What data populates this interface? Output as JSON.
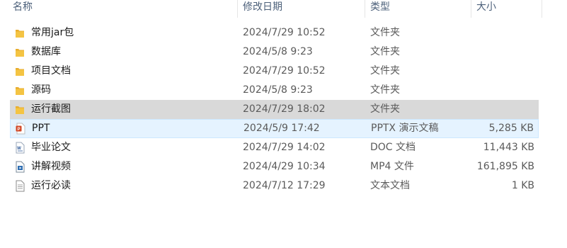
{
  "columns": {
    "name": "名称",
    "date": "修改日期",
    "type": "类型",
    "size": "大小"
  },
  "files": [
    {
      "name": "常用jar包",
      "date": "2024/7/29 10:52",
      "type": "文件夹",
      "size": "",
      "icon": "folder-icon",
      "state": ""
    },
    {
      "name": "数据库",
      "date": "2024/5/8 9:23",
      "type": "文件夹",
      "size": "",
      "icon": "folder-icon",
      "state": ""
    },
    {
      "name": "项目文档",
      "date": "2024/7/29 10:52",
      "type": "文件夹",
      "size": "",
      "icon": "folder-icon",
      "state": ""
    },
    {
      "name": "源码",
      "date": "2024/5/8 9:23",
      "type": "文件夹",
      "size": "",
      "icon": "folder-icon",
      "state": ""
    },
    {
      "name": "运行截图",
      "date": "2024/7/29 18:02",
      "type": "文件夹",
      "size": "",
      "icon": "folder-icon",
      "state": "selected"
    },
    {
      "name": "PPT",
      "date": "2024/5/9 17:42",
      "type": "PPTX 演示文稿",
      "size": "5,285 KB",
      "icon": "pptx-file-icon",
      "state": "hover"
    },
    {
      "name": "毕业论文",
      "date": "2024/7/29 14:02",
      "type": "DOC 文档",
      "size": "11,443 KB",
      "icon": "doc-file-icon",
      "state": ""
    },
    {
      "name": "讲解视频",
      "date": "2024/4/29 10:34",
      "type": "MP4 文件",
      "size": "161,895 KB",
      "icon": "video-file-icon",
      "state": ""
    },
    {
      "name": "运行必读",
      "date": "2024/7/12 17:29",
      "type": "文本文档",
      "size": "1 KB",
      "icon": "text-file-icon",
      "state": ""
    }
  ],
  "colors": {
    "folder": "#f4c443",
    "selected": "#d9d9d9",
    "hover": "#e5f3ff",
    "pptx": "#d24726",
    "doc": "#2b5797"
  }
}
